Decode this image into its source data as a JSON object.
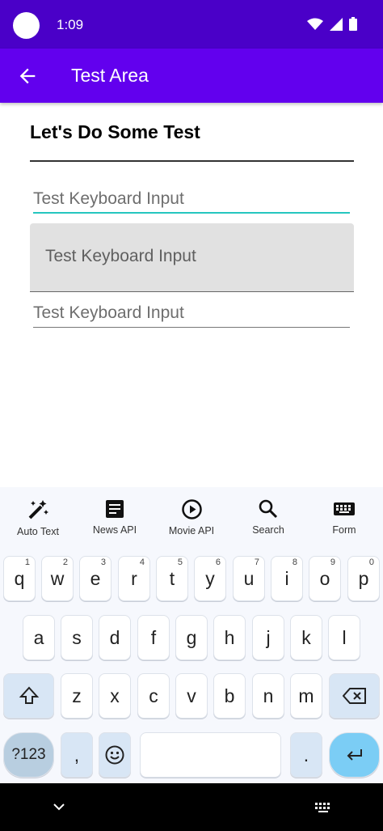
{
  "status": {
    "time": "1:09"
  },
  "app_bar": {
    "title": "Test Area"
  },
  "content": {
    "heading": "Let's Do Some Test",
    "field1_placeholder": "Test Keyboard Input",
    "field2_placeholder": "Test Keyboard Input",
    "field3_placeholder": "Test Keyboard Input"
  },
  "toolbar": {
    "auto_text": "Auto Text",
    "news_api": "News API",
    "movie_api": "Movie API",
    "search": "Search",
    "form": "Form"
  },
  "keys": {
    "q": "q",
    "w": "w",
    "e": "e",
    "r": "r",
    "t": "t",
    "y": "y",
    "u": "u",
    "i": "i",
    "o": "o",
    "p": "p",
    "a": "a",
    "s": "s",
    "d": "d",
    "f": "f",
    "g": "g",
    "h": "h",
    "j": "j",
    "k": "k",
    "l": "l",
    "z": "z",
    "x": "x",
    "c": "c",
    "v": "v",
    "b": "b",
    "n": "n",
    "m": "m",
    "hints": [
      "1",
      "2",
      "3",
      "4",
      "5",
      "6",
      "7",
      "8",
      "9",
      "0"
    ],
    "symbols": "?123",
    "comma": ",",
    "period": "."
  },
  "colors": {
    "status_bar": "#4a00c8",
    "app_bar": "#6200ee",
    "focus_line": "#26c6bf",
    "enter_key": "#7bcdf5"
  }
}
